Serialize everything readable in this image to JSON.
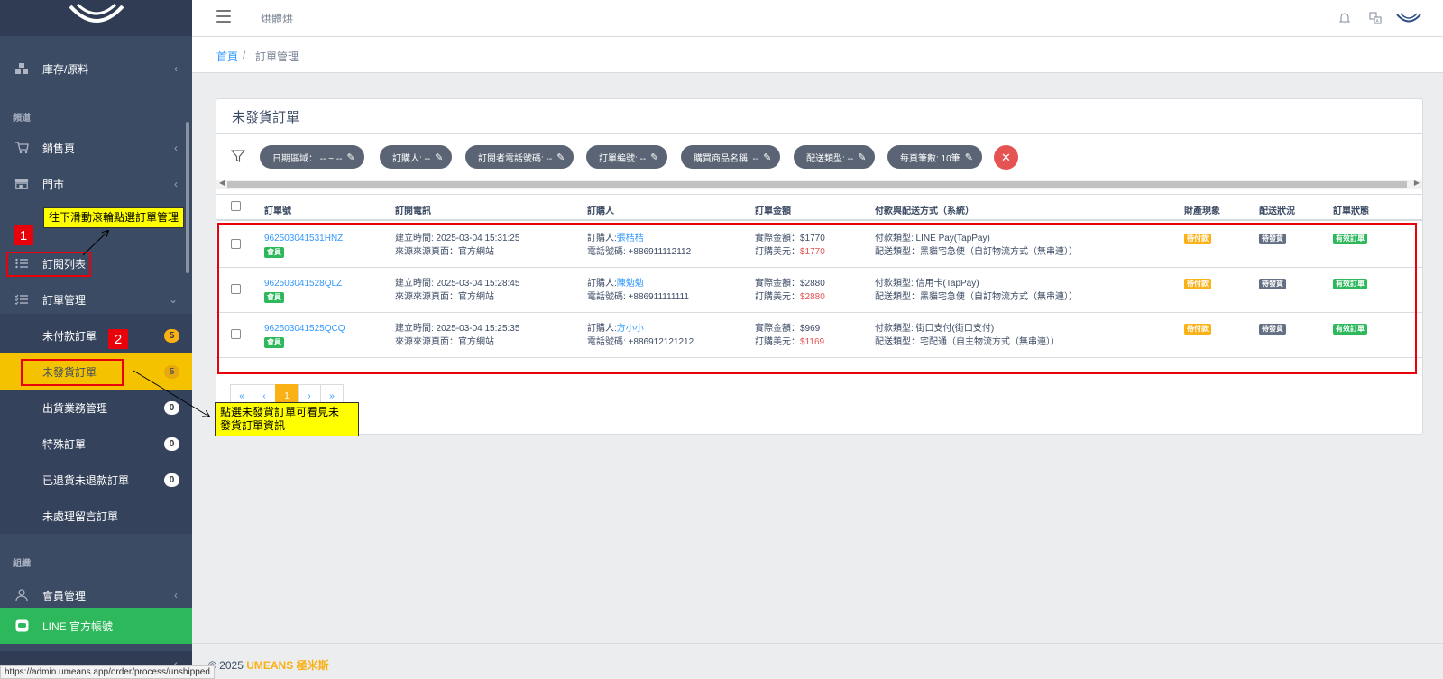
{
  "sidebar": {
    "inventory": "庫存/原料",
    "section_channels": "頻道",
    "sales_page": "銷售頁",
    "store": "門市",
    "order_list": "訂閱列表",
    "order_mgmt": "訂單管理",
    "sub_items": [
      {
        "label": "未付款訂單",
        "badge": "5"
      },
      {
        "label": "未發貨訂單",
        "badge": "5"
      },
      {
        "label": "出貨業務管理",
        "badge": "0"
      },
      {
        "label": "特殊訂單",
        "badge": "0"
      },
      {
        "label": "已退貨未退款訂單",
        "badge": "0"
      },
      {
        "label": "未處理留言訂單",
        "badge": ""
      }
    ],
    "section_org": "組織",
    "members": "會員管理",
    "line_official": "LINE 官方帳號"
  },
  "header": {
    "app_name": "烘體烘"
  },
  "breadcrumb": {
    "home": "首頁",
    "sep": "/",
    "current": "訂單管理"
  },
  "card": {
    "title": "未發貨訂單"
  },
  "filters": [
    "日期區域： -- ~ --",
    "訂購人: --",
    "訂閱者電話號碼: --",
    "訂單編號: --",
    "購買商品名稱: --",
    "配送類型: --",
    "每頁筆數: 10筆"
  ],
  "table": {
    "headers": [
      "訂單號",
      "訂閱電訊",
      "訂購人",
      "訂單金額",
      "付款與配送方式（系統）",
      "財產現象",
      "配送狀況",
      "訂單狀態"
    ],
    "rows": [
      {
        "order_no": "962503041531HNZ",
        "order_tag": "會員",
        "created": "建立時間: 2025-03-04 15:31:25",
        "source": "來源來源頁面：官方網站",
        "buyer_prefix": "訂購人:",
        "buyer": "張桔桔",
        "phone": "電話號碼: +886911112112",
        "amount": "實際金額：$1770",
        "usd_prefix": "訂購美元：",
        "usd": "$1770",
        "pay": "付款類型: LINE Pay(TapPay)",
        "ship": "配送類型：黑貓宅急便（自訂物流方式（無串連））",
        "pay_status": "待付款",
        "ship_status": "待發貨",
        "order_status": "有效訂單"
      },
      {
        "order_no": "962503041528QLZ",
        "order_tag": "會員",
        "created": "建立時間: 2025-03-04 15:28:45",
        "source": "來源來源頁面：官方網站",
        "buyer_prefix": "訂購人:",
        "buyer": "陳勉勉",
        "phone": "電話號碼: +886911111111",
        "amount": "實際金額：$2880",
        "usd_prefix": "訂購美元：",
        "usd": "$2880",
        "pay": "付款類型: 信用卡(TapPay)",
        "ship": "配送類型：黑貓宅急便（自訂物流方式（無串連））",
        "pay_status": "待付款",
        "ship_status": "待發貨",
        "order_status": "有效訂單"
      },
      {
        "order_no": "962503041525QCQ",
        "order_tag": "會員",
        "created": "建立時間: 2025-03-04 15:25:35",
        "source": "來源來源頁面：官方網站",
        "buyer_prefix": "訂購人:",
        "buyer": "方小小",
        "phone": "電話號碼: +886912121212",
        "amount": "實際金額：$969",
        "usd_prefix": "訂購美元：",
        "usd": "$1169",
        "pay": "付款類型: 街口支付(街口支付)",
        "ship": "配送類型：宅配通（自主物流方式（無串連））",
        "pay_status": "待付款",
        "ship_status": "待發貨",
        "order_status": "有效訂單"
      }
    ]
  },
  "pagination": [
    "«",
    "‹",
    "1",
    "›",
    "»"
  ],
  "annotations": {
    "step1": "1",
    "step2": "2",
    "note1": "往下滑動滾輪點選訂單管理",
    "note2_line1": "點選未發貨訂單可看見未",
    "note2_line2": "發貨訂單資訊"
  },
  "footer": {
    "copyright": "© 2025",
    "brand": "UMEANS",
    "brand_cn": "極米斯"
  },
  "status_url": "https://admin.umeans.app/order/process/unshipped",
  "colors": {
    "sidebar": "#3c4b64",
    "active": "#f5c200",
    "line": "#2eb85c",
    "annotation_red": "#e8000b",
    "note_yellow": "#ffff00"
  }
}
